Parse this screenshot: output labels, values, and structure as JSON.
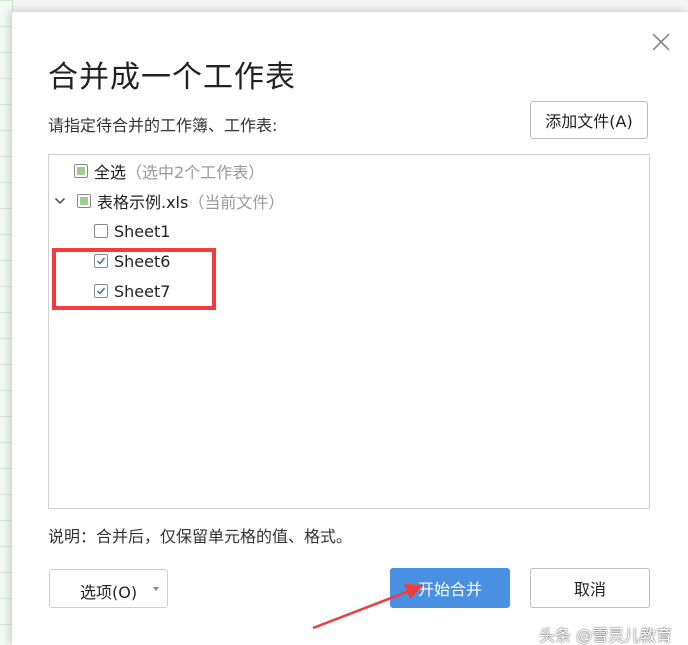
{
  "dialog": {
    "title": "合并成一个工作表",
    "subtitle": "请指定待合并的工作簿、工作表:",
    "add_file_label": "添加文件(A)",
    "note": "说明：合并后，仅保留单元格的值、格式。",
    "options_label": "选项(O)",
    "start_label": "开始合并",
    "cancel_label": "取消"
  },
  "tree": {
    "select_all": {
      "label": "全选",
      "hint": "（选中2个工作表）",
      "state": "partial"
    },
    "workbook": {
      "label": "表格示例.xls",
      "hint": "（当前文件）",
      "state": "partial",
      "expanded": true
    },
    "sheets": [
      {
        "label": "Sheet1",
        "checked": false
      },
      {
        "label": "Sheet6",
        "checked": true
      },
      {
        "label": "Sheet7",
        "checked": true
      }
    ]
  },
  "watermark": "头条 @雪灵儿教育",
  "colors": {
    "accent": "#4a90e2",
    "highlight": "#f03c3c",
    "partial_fill": "#9ecf8e"
  }
}
